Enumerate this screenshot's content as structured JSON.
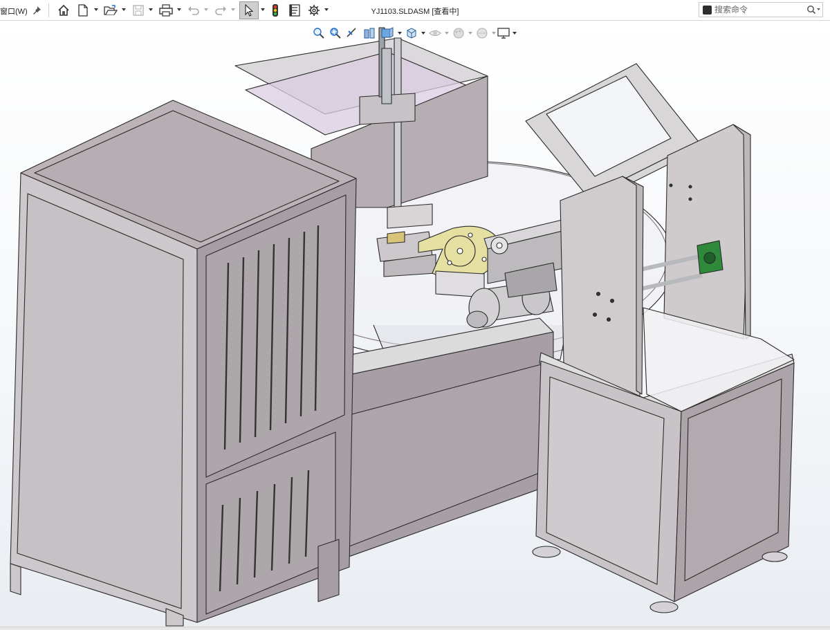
{
  "menu": {
    "window_label": "窗口(W)"
  },
  "document": {
    "title": "YJ1103.SLDASM [查看中]"
  },
  "search": {
    "placeholder": "搜索命令"
  },
  "toolbar": {
    "icons": [
      "home-icon",
      "new-document-icon",
      "open-icon",
      "save-icon",
      "print-icon",
      "undo-icon",
      "redo-icon",
      "select-arrow-icon",
      "rebuild-traffic-light-icon",
      "file-properties-icon",
      "options-gear-icon"
    ]
  },
  "headsup_toolbar": {
    "icons": [
      "zoom-to-fit-icon",
      "zoom-to-area-icon",
      "previous-view-icon",
      "section-view-icon",
      "view-orientation-icon",
      "display-style-icon",
      "hide-show-items-icon",
      "edit-appearance-icon",
      "apply-scene-icon",
      "view-settings-icon"
    ]
  },
  "colors": {
    "cabinet": "#b5adb2",
    "cabinet_light": "#c9c3c6",
    "frame": "#d8d6d6",
    "edge": "#2a2a2a",
    "turntable": "#e3dc9c",
    "bearing": "#2e8a3a",
    "glass": "#cbbfd6"
  }
}
